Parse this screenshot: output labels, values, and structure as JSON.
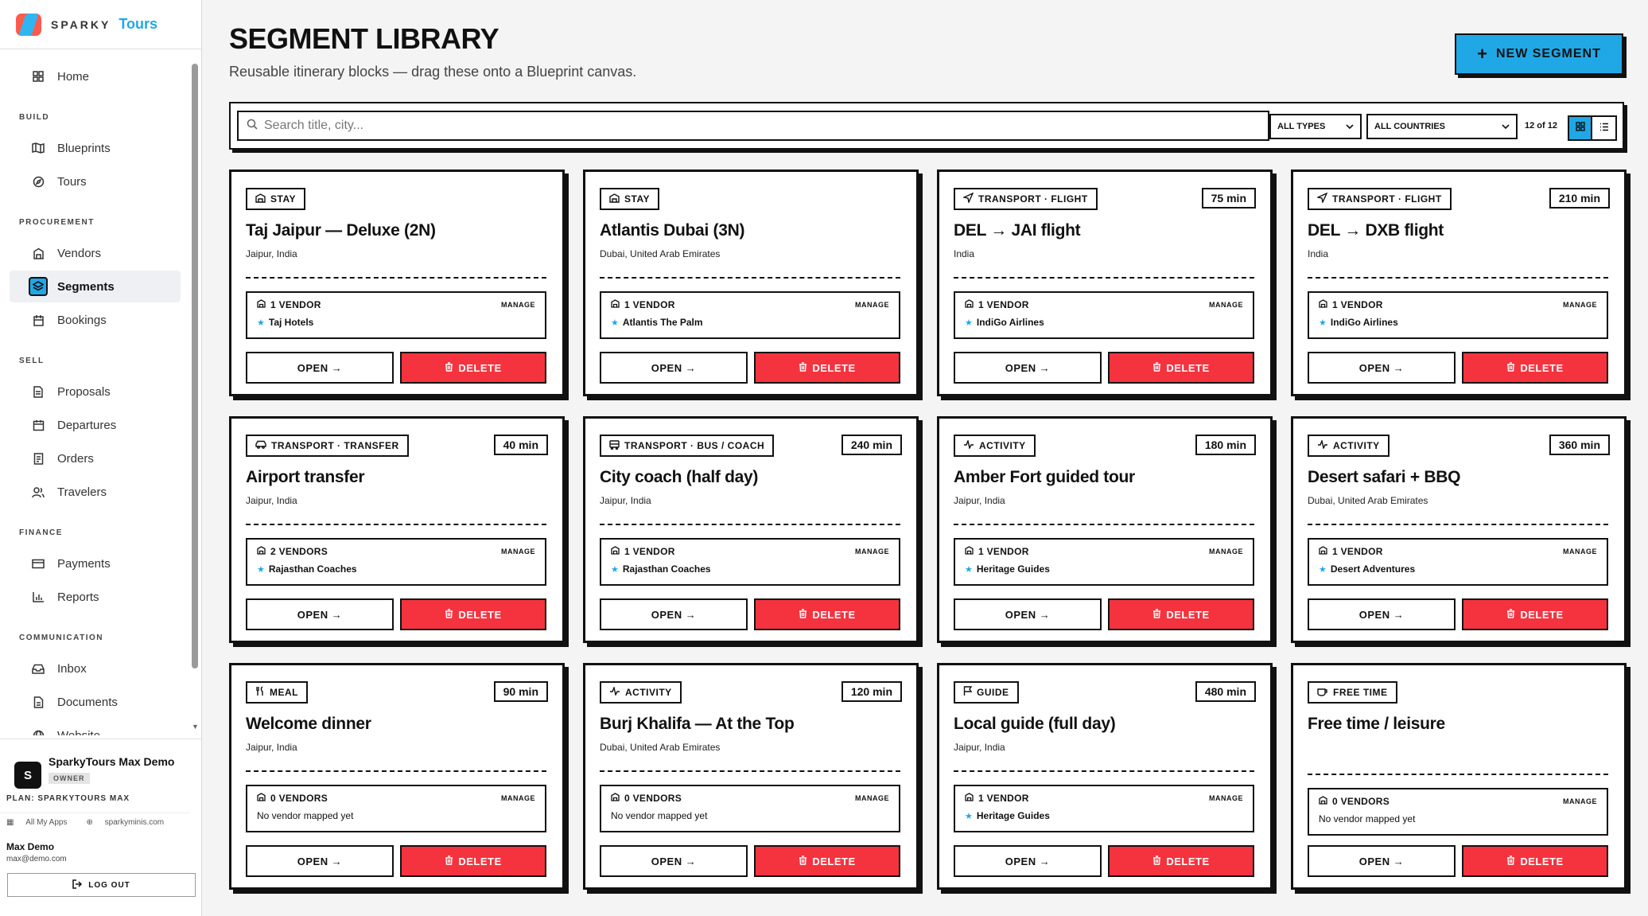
{
  "brand": {
    "sparky": "SPARKY",
    "tours": "Tours"
  },
  "nav": {
    "home": "Home",
    "build_section": "BUILD",
    "blueprints": "Blueprints",
    "tours": "Tours",
    "procurement_section": "PROCUREMENT",
    "vendors": "Vendors",
    "segments": "Segments",
    "bookings": "Bookings",
    "sell_section": "SELL",
    "proposals": "Proposals",
    "departures": "Departures",
    "orders": "Orders",
    "travelers": "Travelers",
    "finance_section": "FINANCE",
    "payments": "Payments",
    "reports": "Reports",
    "communication_section": "COMMUNICATION",
    "inbox": "Inbox",
    "documents": "Documents",
    "website": "Website"
  },
  "workspace": {
    "avatar": "S",
    "name": "SparkyTours Max Demo",
    "role": "OWNER",
    "plan": "PLAN: SPARKYTOURS MAX",
    "all_apps": "All My Apps",
    "site": "sparkyminis.com",
    "user_name": "Max Demo",
    "user_email": "max@demo.com",
    "logout": "LOG OUT"
  },
  "header": {
    "title": "SEGMENT LIBRARY",
    "subtitle": "Reusable itinerary blocks — drag these onto a Blueprint canvas.",
    "new_button": "NEW SEGMENT"
  },
  "filters": {
    "search_placeholder": "Search title, city...",
    "types": "ALL TYPES",
    "countries": "ALL COUNTRIES",
    "count": "12 of 12"
  },
  "labels": {
    "manage": "MANAGE",
    "open": "OPEN →",
    "delete": "DELETE"
  },
  "cards": [
    {
      "type": "STAY",
      "icon": "building-icon",
      "duration": "",
      "title": "Taj Jaipur — Deluxe (2N)",
      "location": "Jaipur, India",
      "vendors": "1 VENDOR",
      "vendor_name": "Taj Hotels"
    },
    {
      "type": "STAY",
      "icon": "building-icon",
      "duration": "",
      "title": "Atlantis Dubai (3N)",
      "location": "Dubai, United Arab Emirates",
      "vendors": "1 VENDOR",
      "vendor_name": "Atlantis The Palm"
    },
    {
      "type": "TRANSPORT · FLIGHT",
      "icon": "plane-icon",
      "duration": "75 min",
      "title": "DEL → JAI flight",
      "location": "India",
      "vendors": "1 VENDOR",
      "vendor_name": "IndiGo Airlines"
    },
    {
      "type": "TRANSPORT · FLIGHT",
      "icon": "plane-icon",
      "duration": "210 min",
      "title": "DEL → DXB flight",
      "location": "India",
      "vendors": "1 VENDOR",
      "vendor_name": "IndiGo Airlines"
    },
    {
      "type": "TRANSPORT · TRANSFER",
      "icon": "car-icon",
      "duration": "40 min",
      "title": "Airport transfer",
      "location": "Jaipur, India",
      "vendors": "2 VENDORS",
      "vendor_name": "Rajasthan Coaches"
    },
    {
      "type": "TRANSPORT · BUS / COACH",
      "icon": "bus-icon",
      "duration": "240 min",
      "title": "City coach (half day)",
      "location": "Jaipur, India",
      "vendors": "1 VENDOR",
      "vendor_name": "Rajasthan Coaches"
    },
    {
      "type": "ACTIVITY",
      "icon": "activity-icon",
      "duration": "180 min",
      "title": "Amber Fort guided tour",
      "location": "Jaipur, India",
      "vendors": "1 VENDOR",
      "vendor_name": "Heritage Guides"
    },
    {
      "type": "ACTIVITY",
      "icon": "activity-icon",
      "duration": "360 min",
      "title": "Desert safari + BBQ",
      "location": "Dubai, United Arab Emirates",
      "vendors": "1 VENDOR",
      "vendor_name": "Desert Adventures"
    },
    {
      "type": "MEAL",
      "icon": "utensils-icon",
      "duration": "90 min",
      "title": "Welcome dinner",
      "location": "Jaipur, India",
      "vendors": "0 VENDORS",
      "vendor_name": "No vendor mapped yet"
    },
    {
      "type": "ACTIVITY",
      "icon": "activity-icon",
      "duration": "120 min",
      "title": "Burj Khalifa — At the Top",
      "location": "Dubai, United Arab Emirates",
      "vendors": "0 VENDORS",
      "vendor_name": "No vendor mapped yet"
    },
    {
      "type": "GUIDE",
      "icon": "flag-icon",
      "duration": "480 min",
      "title": "Local guide (full day)",
      "location": "Jaipur, India",
      "vendors": "1 VENDOR",
      "vendor_name": "Heritage Guides"
    },
    {
      "type": "FREE TIME",
      "icon": "coffee-icon",
      "duration": "",
      "title": "Free time / leisure",
      "location": "",
      "vendors": "0 VENDORS",
      "vendor_name": "No vendor mapped yet"
    }
  ]
}
